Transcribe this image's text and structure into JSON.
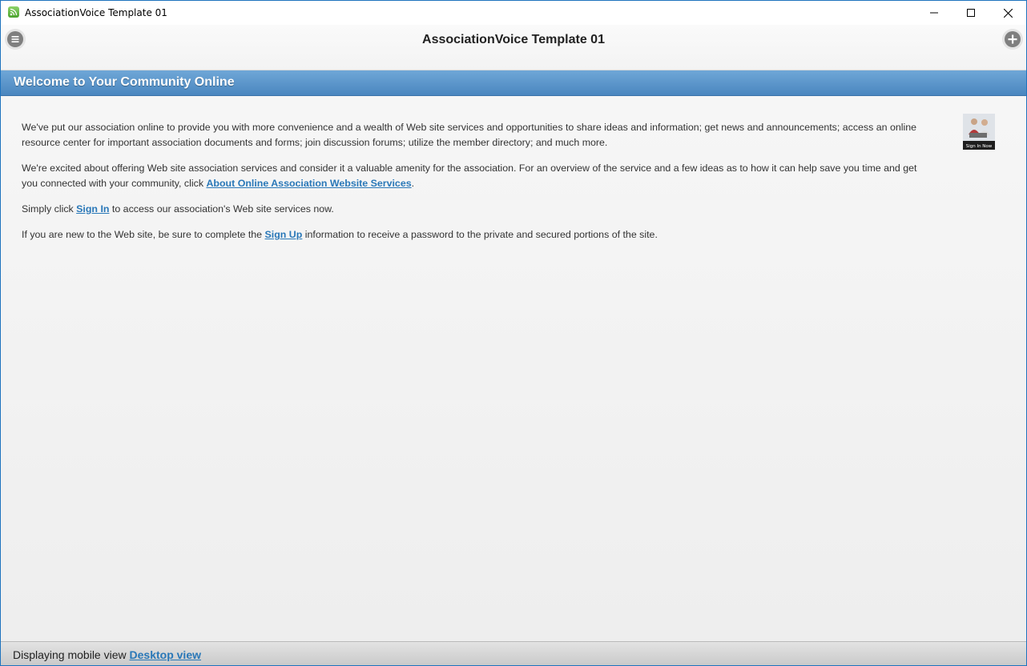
{
  "window": {
    "title": "AssociationVoice Template 01",
    "controls": [
      "minimize-icon",
      "maximize-icon",
      "close-icon"
    ]
  },
  "header": {
    "title": "AssociationVoice Template 01",
    "left_button_icon": "menu-icon",
    "right_button_icon": "plus-circle-icon"
  },
  "band": {
    "title": "Welcome to Your Community Online",
    "color": "#5a95c9"
  },
  "content": {
    "p1": "We've put our association online to provide you with more convenience and a wealth of Web site services and opportunities to share ideas and information; get news and announcements; access an online resource center for important association documents and forms; join discussion forums; utilize the member directory; and much more.",
    "p2_before": "We're excited about offering Web site association services and consider it a valuable amenity for the association. For an overview of the service and a few ideas as to how it can help save you time and get you connected with your community, click ",
    "p2_link": "About Online Association Website Services",
    "p2_after": ".",
    "p3_before": "Simply click ",
    "p3_link": "Sign In",
    "p3_after": " to access our association's Web site services now.",
    "p4_before": "If you are new to the Web site, be sure to complete the ",
    "p4_link": "Sign Up",
    "p4_after": " information to receive a password to the private and secured portions of the site.",
    "image_caption": "Sign In Now",
    "link_color": "#2a78b8"
  },
  "footer": {
    "label": "Displaying mobile view",
    "link": "Desktop view"
  }
}
